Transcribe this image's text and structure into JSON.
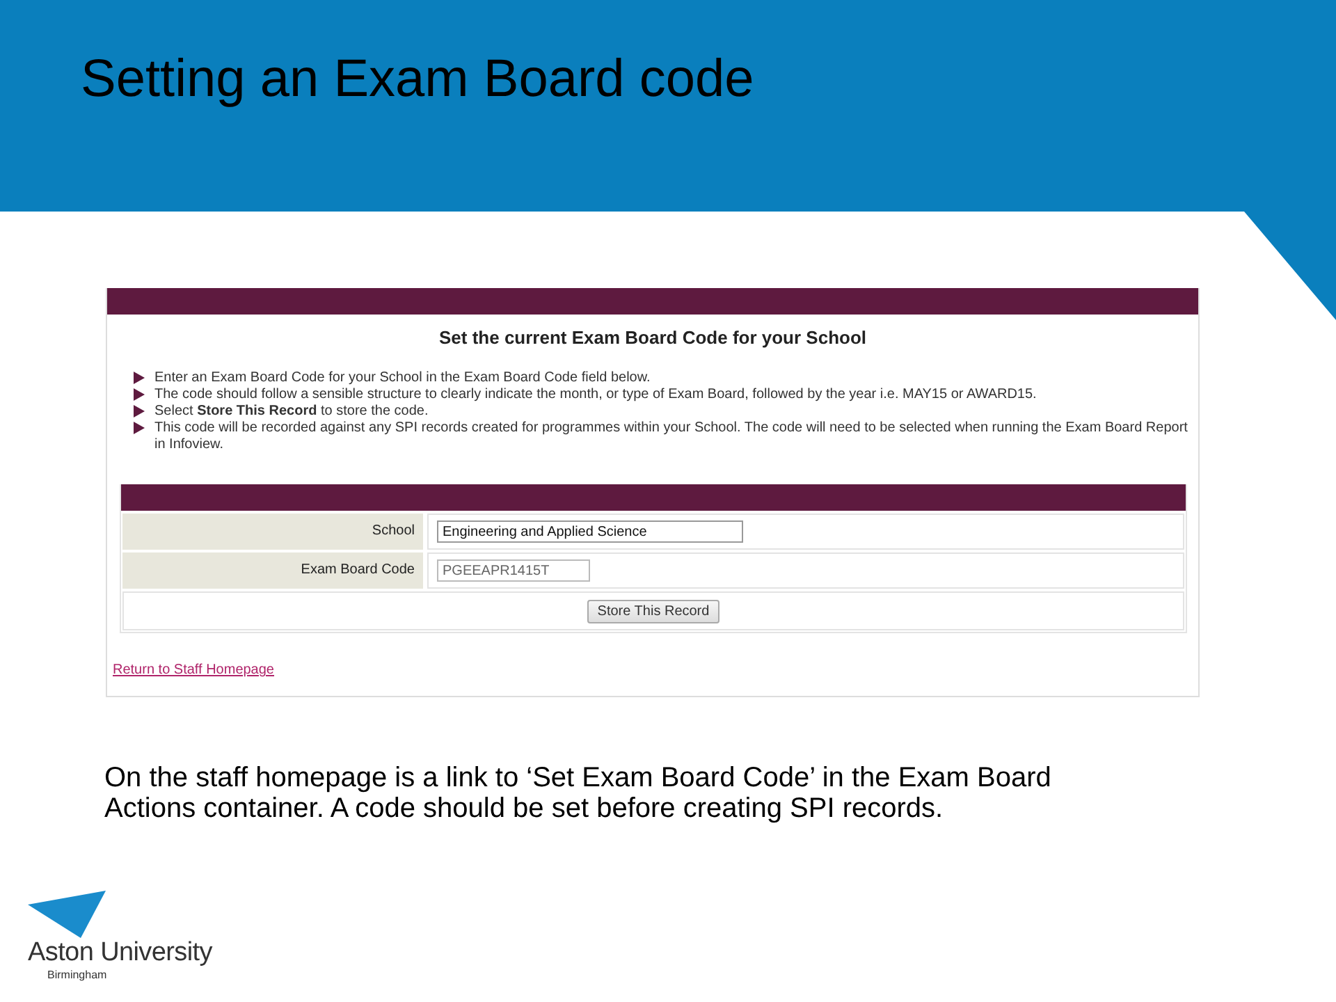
{
  "slide": {
    "title": "Setting an Exam Board code"
  },
  "form_page": {
    "heading": "Set the current Exam Board Code for your School",
    "instructions": [
      "Enter an Exam Board Code for your School in the Exam Board Code field below.",
      "The code should follow a sensible structure to clearly indicate the month, or type of Exam Board, followed by the year i.e. MAY15 or AWARD15.",
      "Select **Store This Record** to store the code.",
      "This code will be recorded against any SPI records created for programmes within your School. The code will need to be selected when running the Exam Board Report in Infoview."
    ],
    "fields": [
      {
        "label": "School",
        "value": "Engineering and Applied Science",
        "disabled": false
      },
      {
        "label": "Exam Board Code",
        "value": "PGEEAPR1415T",
        "disabled": true
      }
    ],
    "submit_button": "Store This Record",
    "link": "Return to Staff Homepage"
  },
  "caption": "On the staff homepage is a link to ‘Set Exam Board Code’ in the Exam Board Actions container. A code should be set before creating SPI records.",
  "logo": {
    "name": "Aston University",
    "place": "Birmingham"
  }
}
